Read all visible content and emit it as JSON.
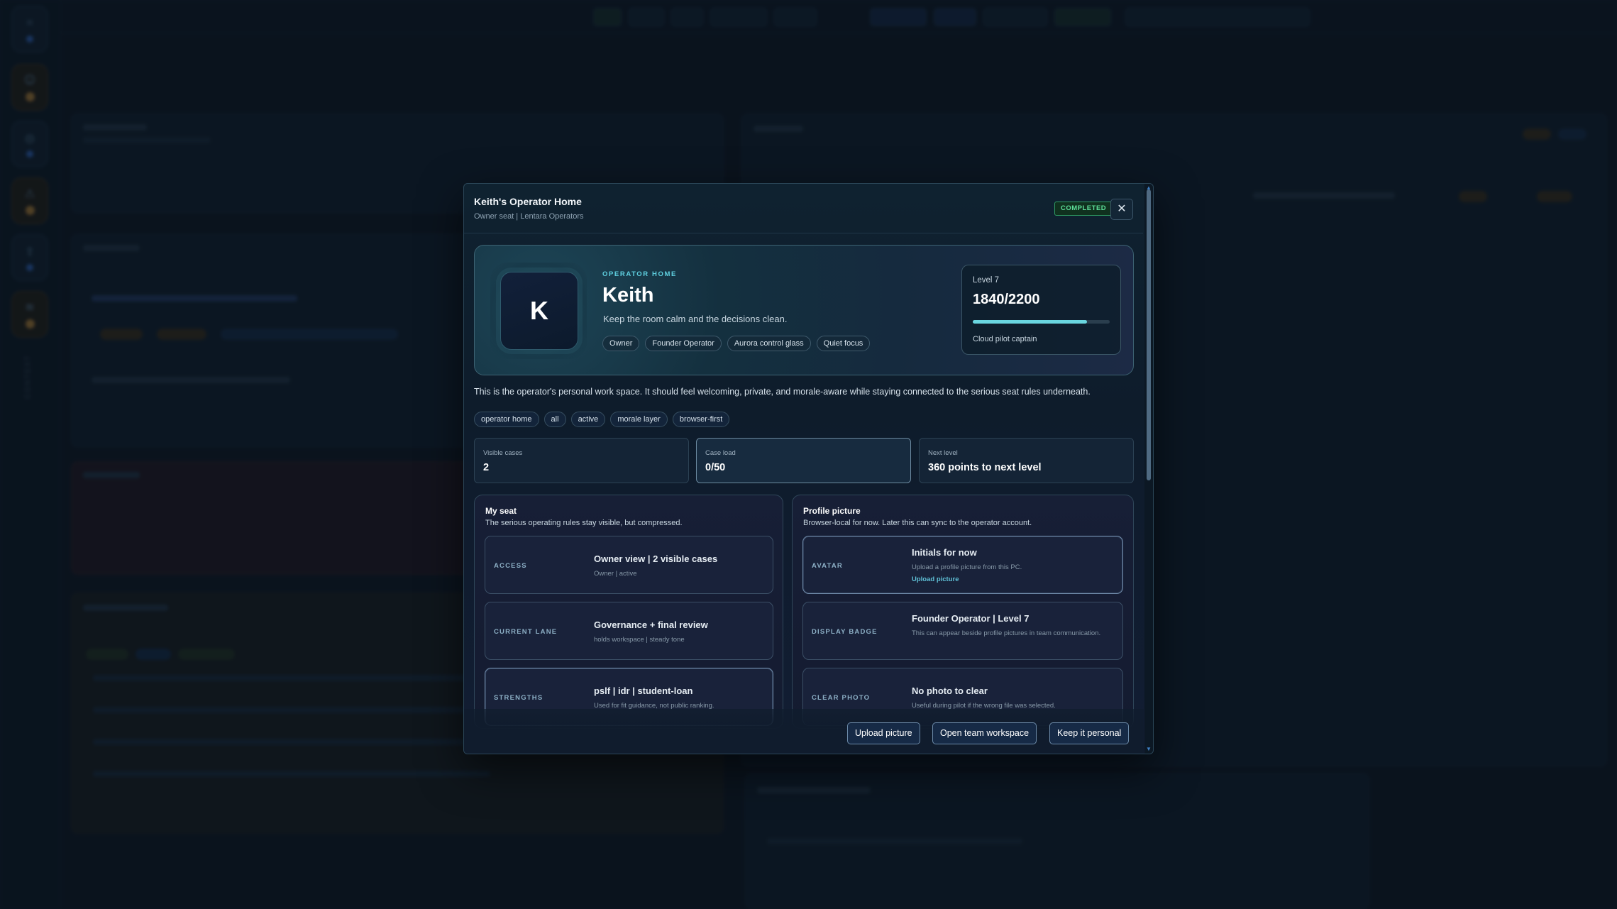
{
  "background": {
    "rail_label": "CONTEXT"
  },
  "modal": {
    "title": "Keith's Operator Home",
    "subtitle": "Owner seat | Lentara Operators",
    "status": "COMPLETED",
    "close_glyph": "✕"
  },
  "hero": {
    "avatar_initial": "K",
    "eyebrow": "OPERATOR HOME",
    "name": "Keith",
    "tagline": "Keep the room calm and the decisions clean.",
    "tags": [
      "Owner",
      "Founder Operator",
      "Aurora control glass",
      "Quiet focus"
    ],
    "level": {
      "label": "Level 7",
      "points": "1840/2200",
      "progress": 0.836,
      "caption": "Cloud pilot captain"
    }
  },
  "intro": "This is the operator's personal work space. It should feel welcoming, private, and morale-aware while staying connected to the serious seat rules underneath.",
  "filters": [
    "operator home",
    "all",
    "active",
    "morale layer",
    "browser-first"
  ],
  "stats": [
    {
      "label": "Visible cases",
      "value": "2"
    },
    {
      "label": "Case load",
      "value": "0/50"
    },
    {
      "label": "Next level",
      "value": "360 points to next level"
    }
  ],
  "my_seat": {
    "title": "My seat",
    "subtitle": "The serious operating rules stay visible, but compressed.",
    "rows": [
      {
        "key": "ACCESS",
        "title": "Owner view | 2 visible cases",
        "desc": "Owner | active"
      },
      {
        "key": "CURRENT LANE",
        "title": "Governance + final review",
        "desc": "holds workspace | steady tone"
      },
      {
        "key": "STRENGTHS",
        "title": "pslf | idr | student-loan",
        "desc": "Used for fit guidance, not public ranking."
      }
    ]
  },
  "profile_picture": {
    "title": "Profile picture",
    "subtitle": "Browser-local for now. Later this can sync to the operator account.",
    "rows": [
      {
        "key": "AVATAR",
        "title": "Initials for now",
        "desc": "Upload a profile picture from this PC.",
        "link": "Upload picture"
      },
      {
        "key": "DISPLAY BADGE",
        "title": "Founder Operator | Level 7",
        "desc": "This can appear beside profile pictures in team communication."
      },
      {
        "key": "CLEAR PHOTO",
        "title": "No photo to clear",
        "desc": "Useful during pilot if the wrong file was selected."
      }
    ]
  },
  "footer": {
    "upload": "Upload picture",
    "open_team": "Open team workspace",
    "keep_personal": "Keep it personal"
  },
  "colors": {
    "accent": "#5fd0e0",
    "status_green": "#5ee09a",
    "brand_amber": "#f0a93b"
  }
}
